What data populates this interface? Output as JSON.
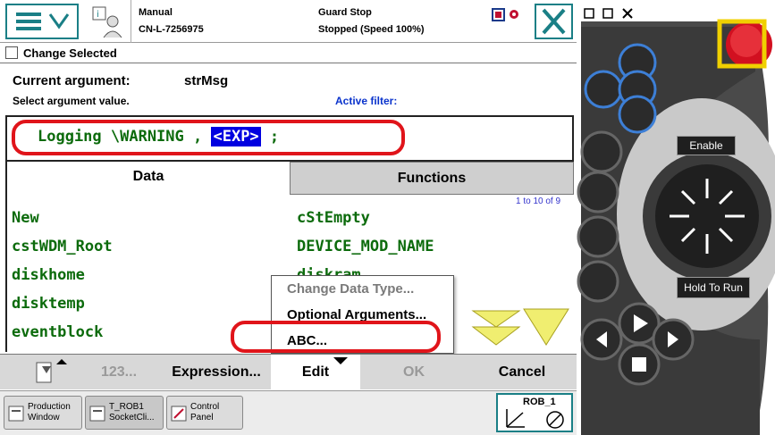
{
  "header": {
    "mode": "Manual",
    "controller": "CN-L-7256975",
    "guard": "Guard Stop",
    "status": "Stopped (Speed 100%)"
  },
  "subheader": {
    "title": "Change Selected"
  },
  "argument": {
    "label": "Current argument:",
    "value": "strMsg",
    "instruction": "Select argument value.",
    "filter_label": "Active filter:"
  },
  "expression": {
    "prefix": "Logging \\WARNING ,",
    "selected": "<EXP>",
    "suffix": ";"
  },
  "tabs": {
    "data": "Data",
    "functions": "Functions"
  },
  "list": {
    "range": "1 to 10 of 9",
    "left": [
      "New",
      "cstWDM_Root",
      "diskhome",
      "disktemp",
      "eventblock"
    ],
    "right": [
      "cStEmpty",
      "DEVICE_MOD_NAME",
      "diskram"
    ]
  },
  "popup": {
    "items": [
      "Change Data Type...",
      "Optional Arguments...",
      "ABC..."
    ]
  },
  "bottombar": {
    "num": "123...",
    "expression": "Expression...",
    "edit": "Edit",
    "ok": "OK",
    "cancel": "Cancel"
  },
  "taskbar": {
    "production": [
      "Production",
      "Window"
    ],
    "task": [
      "T_ROB1",
      "SocketCli..."
    ],
    "control": [
      "Control",
      "Panel"
    ],
    "robot": "ROB_1"
  },
  "pendant": {
    "enable": "Enable",
    "hold": "Hold To Run"
  },
  "colors": {
    "accent": "#1a7f86",
    "code_green": "#0c6b0c",
    "highlight_red": "#e0141a",
    "selection_blue": "#0000e0"
  }
}
